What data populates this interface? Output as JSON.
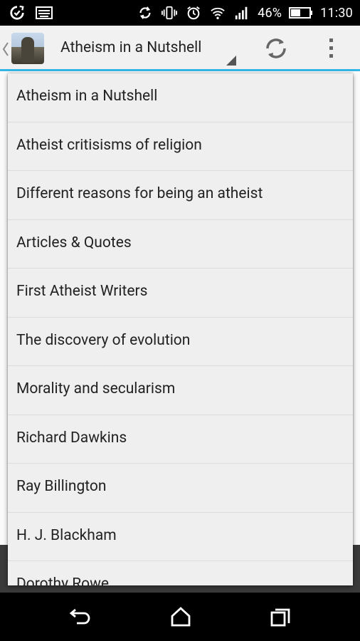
{
  "status_bar": {
    "battery_percent": "46%",
    "time": "11:30",
    "icons": [
      "sync-icon",
      "keyboard-icon",
      "sync-circle-icon",
      "vibrate-icon",
      "alarm-icon",
      "wifi-icon",
      "signal-icon",
      "battery-icon"
    ]
  },
  "action_bar": {
    "title": "Atheism in a Nutshell",
    "actions": [
      "refresh-icon",
      "overflow-menu-icon"
    ]
  },
  "dropdown": {
    "items": [
      "Atheism in a Nutshell",
      "Atheist critisisms of religion",
      "Different reasons for being an atheist",
      "Articles & Quotes",
      "First Atheist Writers",
      "The discovery of evolution",
      "Morality and secularism",
      "Richard Dawkins",
      "Ray Billington",
      "H. J. Blackham",
      "Dorothy Rowe"
    ]
  },
  "nav_bar": {
    "buttons": [
      "back-icon",
      "home-icon",
      "recents-icon"
    ]
  },
  "colors": {
    "accent": "#33b5e5",
    "action_bar_bg": "#f1f1f1",
    "dropdown_bg": "#efefef",
    "text": "#222222"
  }
}
